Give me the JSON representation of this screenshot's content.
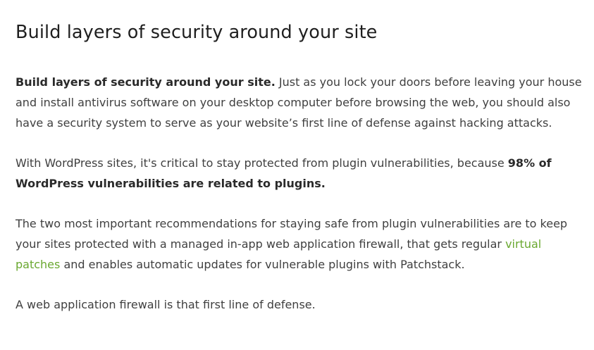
{
  "article": {
    "heading": "Build layers of security around your site",
    "p1": {
      "strong": "Build layers of security around your site.",
      "text": " Just as you lock your doors before leaving your house and install antivirus software on your desktop computer before browsing the web, you should also have a security system to serve as your website’s first line of defense against hacking attacks."
    },
    "p2": {
      "text": "With WordPress sites, it's critical to stay protected from plugin vulnerabilities, because ",
      "strong": "98% of WordPress vulnerabilities are related to plugins."
    },
    "p3": {
      "text_before": "The two most important recommendations for staying safe from plugin vulnerabilities are to keep your sites protected with a managed in-app web application firewall, that gets regular ",
      "link": "virtual patches",
      "text_after": " and enables automatic updates for vulnerable plugins with Patchstack."
    },
    "p4": {
      "text": "A web application firewall is that first line of defense."
    }
  },
  "colors": {
    "link": "#6aa830",
    "text": "#3f3f3f",
    "heading": "#1f1f1f"
  }
}
